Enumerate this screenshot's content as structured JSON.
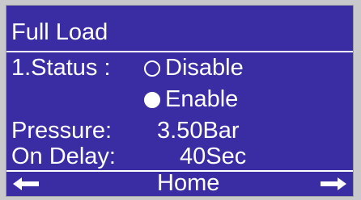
{
  "screen": {
    "title": "Full Load",
    "status": {
      "label": "1.Status :",
      "options": [
        {
          "label": "Disable",
          "selected": false
        },
        {
          "label": "Enable",
          "selected": true
        }
      ]
    },
    "pressure": {
      "label": "Pressure:",
      "value": "3.50Bar"
    },
    "on_delay": {
      "label": "On Delay:",
      "value": "40Sec"
    },
    "nav": {
      "home_label": "Home",
      "left_icon": "arrow-left-icon",
      "right_icon": "arrow-right-icon"
    }
  },
  "colors": {
    "screen_bg": "#3a2ca3",
    "text": "#ffffff",
    "bezel": "#c9c9cc"
  }
}
